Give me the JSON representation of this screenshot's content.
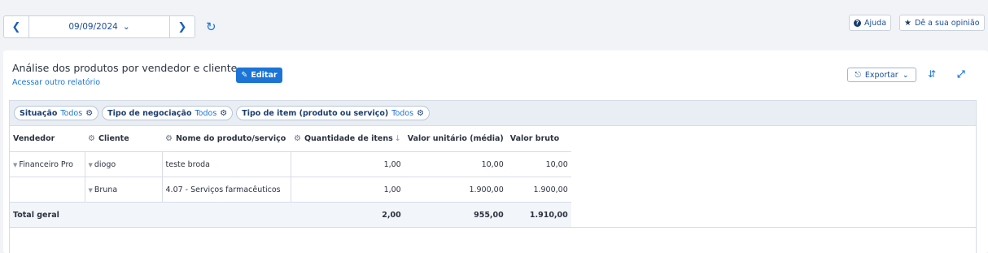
{
  "toolbar": {
    "date": "09/09/2024",
    "help_label": "Ajuda",
    "feedback_label": "Dê a sua opinião"
  },
  "report": {
    "title": "Análise dos produtos por vendedor e cliente",
    "other_report_link": "Acessar outro relatório",
    "edit_label": "Editar",
    "export_label": "Exportar"
  },
  "filters": [
    {
      "label": "Situação",
      "value": "Todos"
    },
    {
      "label": "Tipo de negociação",
      "value": "Todos"
    },
    {
      "label": "Tipo de item (produto ou serviço)",
      "value": "Todos"
    }
  ],
  "table": {
    "headers": {
      "seller": "Vendedor",
      "client": "Cliente",
      "product": "Nome do produto/serviço",
      "quantity": "Quantidade de itens",
      "unit_value": "Valor unitário (média)",
      "gross_value": "Valor bruto"
    },
    "rows": [
      {
        "seller": "Financeiro Pro",
        "client": "diogo",
        "product": "teste broda",
        "quantity": "1,00",
        "unit_value": "10,00",
        "gross_value": "10,00"
      },
      {
        "seller": "",
        "client": "Bruna",
        "product": "4.07 - Serviços farmacêuticos",
        "quantity": "1,00",
        "unit_value": "1.900,00",
        "gross_value": "1.900,00"
      }
    ],
    "total": {
      "label": "Total geral",
      "quantity": "2,00",
      "unit_value": "955,00",
      "gross_value": "1.910,00"
    }
  },
  "colors": {
    "accent": "#1b74d6",
    "background": "#f1f3f7"
  }
}
